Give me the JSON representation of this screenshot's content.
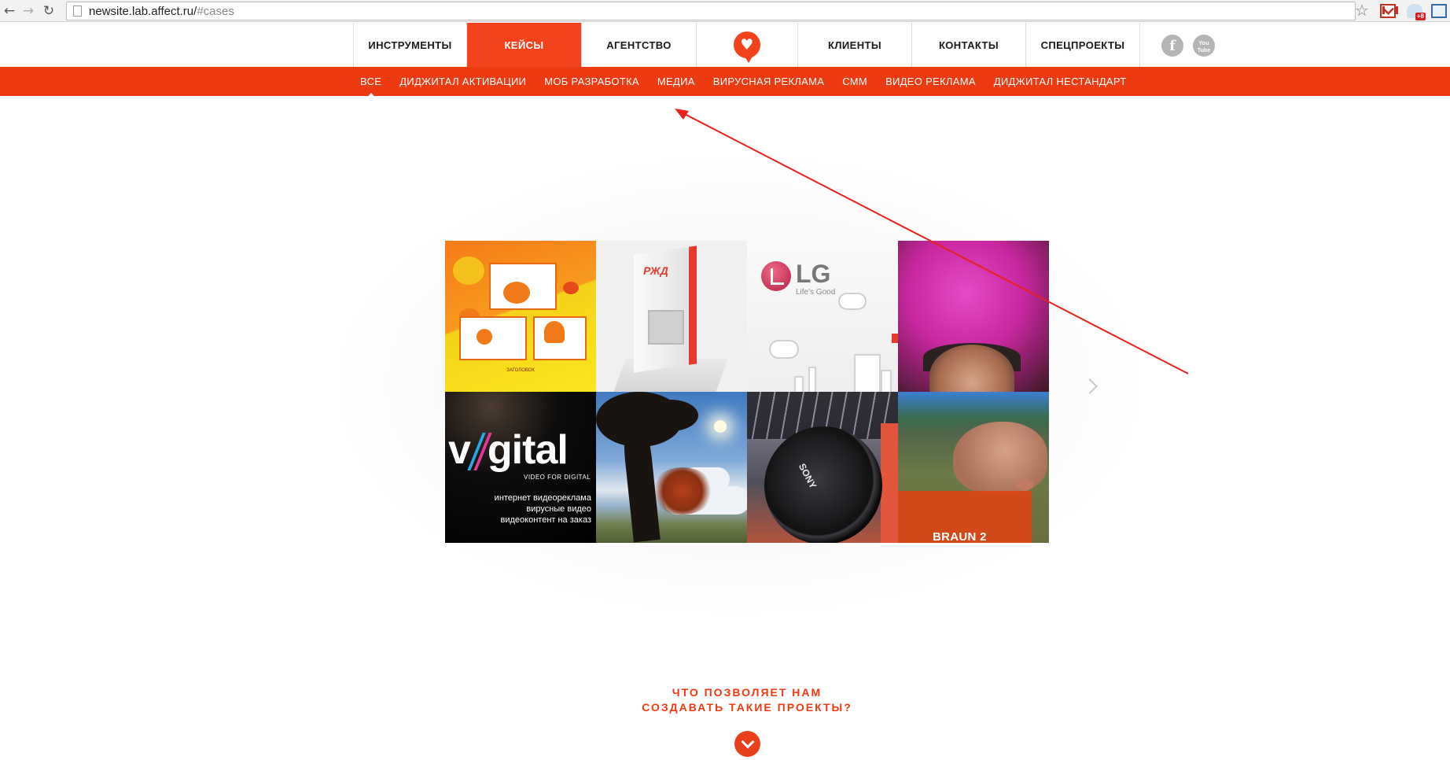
{
  "browser": {
    "url_main": "newsite.lab.affect.ru/",
    "url_hash": "#cases",
    "ext_badge": "+8"
  },
  "header": {
    "nav": [
      {
        "label": "ИНСТРУМЕНТЫ"
      },
      {
        "label": "КЕЙСЫ",
        "active": true
      },
      {
        "label": "АГЕНТСТВО"
      },
      {
        "label": "КЛИЕНТЫ"
      },
      {
        "label": "КОНТАКТЫ"
      },
      {
        "label": "СПЕЦПРОЕКТЫ"
      }
    ],
    "social": {
      "facebook": "f",
      "youtube_line1": "You",
      "youtube_line2": "Tube"
    }
  },
  "subnav": {
    "items": [
      {
        "label": "ВСЕ",
        "active": true
      },
      {
        "label": "ДИДЖИТАЛ АКТИВАЦИИ"
      },
      {
        "label": "МОБ РАЗРАБОТКА"
      },
      {
        "label": "МЕДИА"
      },
      {
        "label": "ВИРУСНАЯ РЕКЛАМА"
      },
      {
        "label": "СММ"
      },
      {
        "label": "ВИДЕО РЕКЛАМА"
      },
      {
        "label": "ДИДЖИТАЛ НЕСТАНДАРТ"
      }
    ]
  },
  "tiles": {
    "rzd_logo": "РЖД",
    "lg_text": "LG",
    "lg_sub": "Life's Good",
    "vigital_v": "v",
    "vigital_rest": "gital",
    "vigital_tag": "VIDEO FOR DIGITAL",
    "vigital_line1": "интернет видеореклама",
    "vigital_line2": "вирусные видео",
    "vigital_line3": "видеоконтент на заказ",
    "sony": "SONY",
    "braun": "BRAUN 2"
  },
  "bottom": {
    "line1": "ЧТО ПОЗВОЛЯЕТ НАМ",
    "line2": "СОЗДАВАТЬ ТАКИЕ ПРОЕКТЫ?"
  },
  "colors": {
    "accent": "#f4431c",
    "subnav_bg": "#ee3a10",
    "annotation": "#e8211a"
  }
}
